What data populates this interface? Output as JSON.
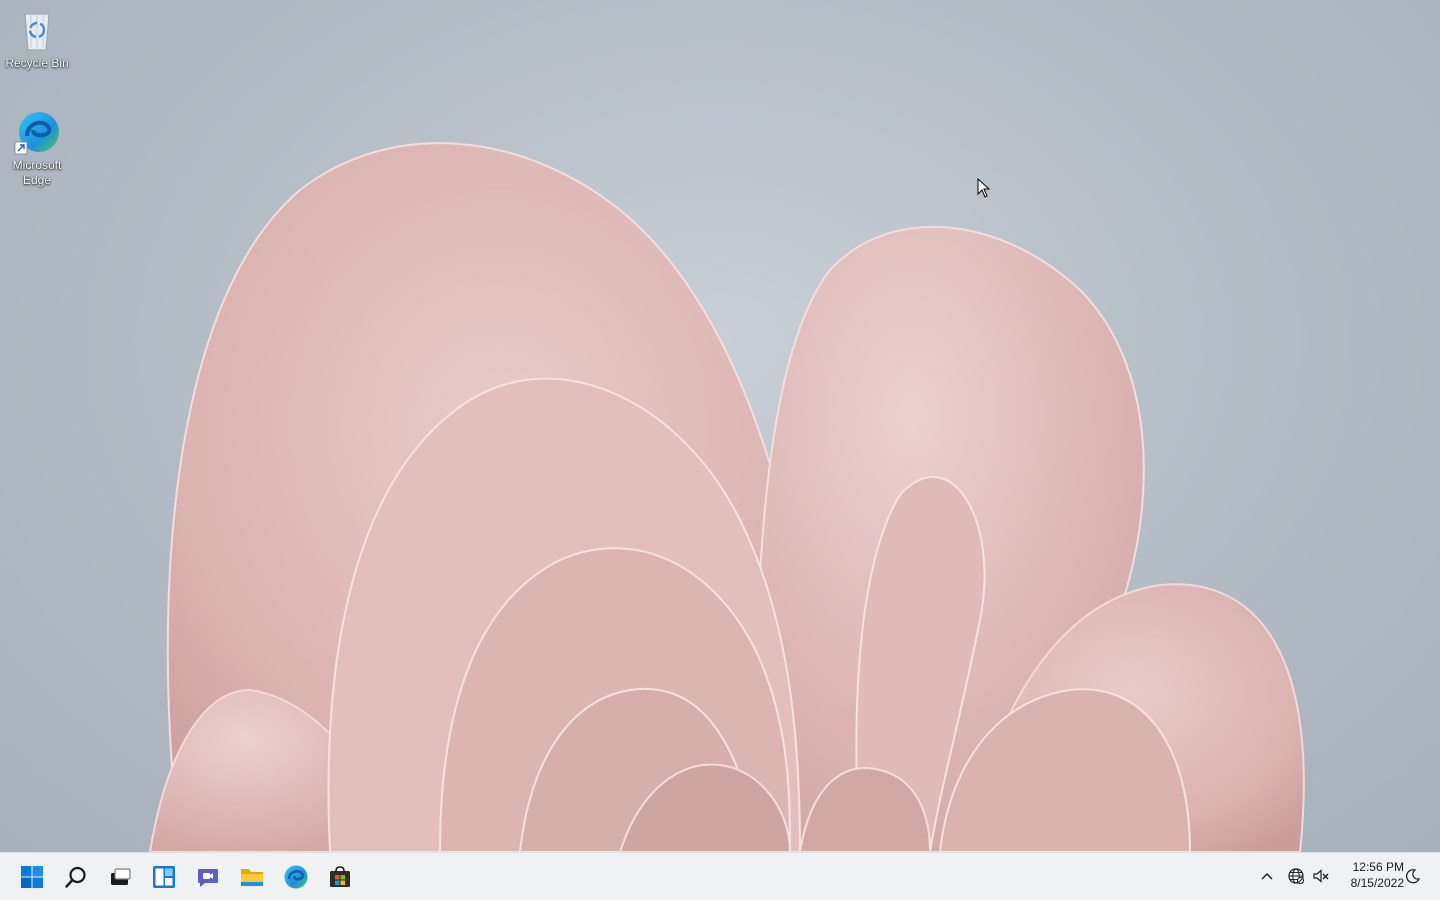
{
  "desktop": {
    "icons": [
      {
        "label": "Recycle Bin",
        "icon": "recycle-bin-icon"
      },
      {
        "label": "Microsoft Edge",
        "icon": "edge-icon"
      }
    ]
  },
  "taskbar": {
    "buttons": [
      {
        "name": "Start",
        "icon": "windows-start-icon"
      },
      {
        "name": "Search",
        "icon": "search-icon"
      },
      {
        "name": "Task View",
        "icon": "task-view-icon"
      },
      {
        "name": "Widgets",
        "icon": "widgets-icon"
      },
      {
        "name": "Chat",
        "icon": "chat-icon"
      },
      {
        "name": "File Explorer",
        "icon": "folder-icon"
      },
      {
        "name": "Microsoft Edge",
        "icon": "edge-icon"
      },
      {
        "name": "Microsoft Store",
        "icon": "store-icon"
      }
    ],
    "tray": {
      "chevron_icon": "chevron-up-icon",
      "network_icon": "network-globe-icon",
      "volume_icon": "volume-muted-icon",
      "time": "12:56 PM",
      "date": "8/15/2022",
      "notification_icon": "moon-icon"
    }
  },
  "colors": {
    "taskbar_bg": "#eff1f3",
    "accent_blue": "#0078d4",
    "wallpaper_petal": "#e6c5c3"
  }
}
